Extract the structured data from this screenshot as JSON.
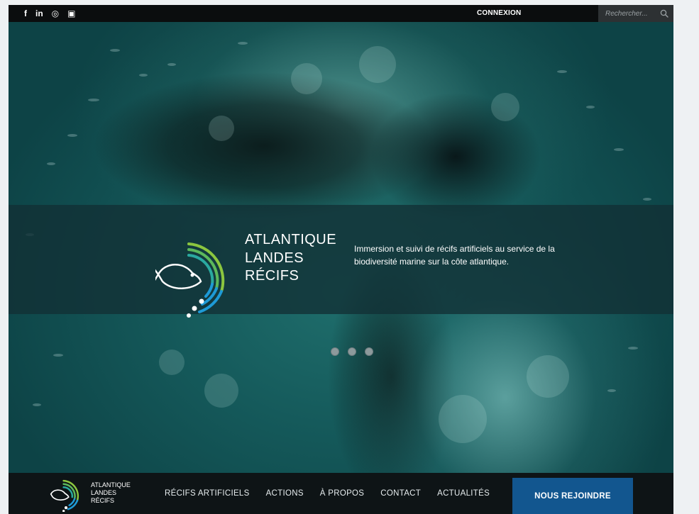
{
  "topbar": {
    "social": [
      {
        "icon": "facebook-icon",
        "glyph": "f"
      },
      {
        "icon": "linkedin-icon",
        "glyph": "in"
      },
      {
        "icon": "instagram-icon",
        "glyph": "◎"
      },
      {
        "icon": "youtube-icon",
        "glyph": "▣"
      }
    ],
    "login_label": "CONNEXION",
    "search_placeholder": "Rechercher..."
  },
  "hero": {
    "brand_lines": [
      "ATLANTIQUE",
      "LANDES",
      "RÉCIFS"
    ],
    "tagline": "Immersion et suivi de récifs artificiels au service de la biodiversité marine sur la côte atlantique.",
    "slides": 3
  },
  "nav": {
    "brand_lines": [
      "ATLANTIQUE",
      "LANDES",
      "RÉCIFS"
    ],
    "items": [
      "RÉCIFS ARTIFICIELS",
      "ACTIONS",
      "À PROPOS",
      "CONTACT",
      "ACTUALITÉS"
    ],
    "cta": "NOUS REJOINDRE"
  },
  "colors": {
    "topbar": "#0b0d0e",
    "band": "#12303 4",
    "cta": "#12568f",
    "logo_green": "#8cc63f",
    "logo_blue": "#1e9ad6"
  }
}
